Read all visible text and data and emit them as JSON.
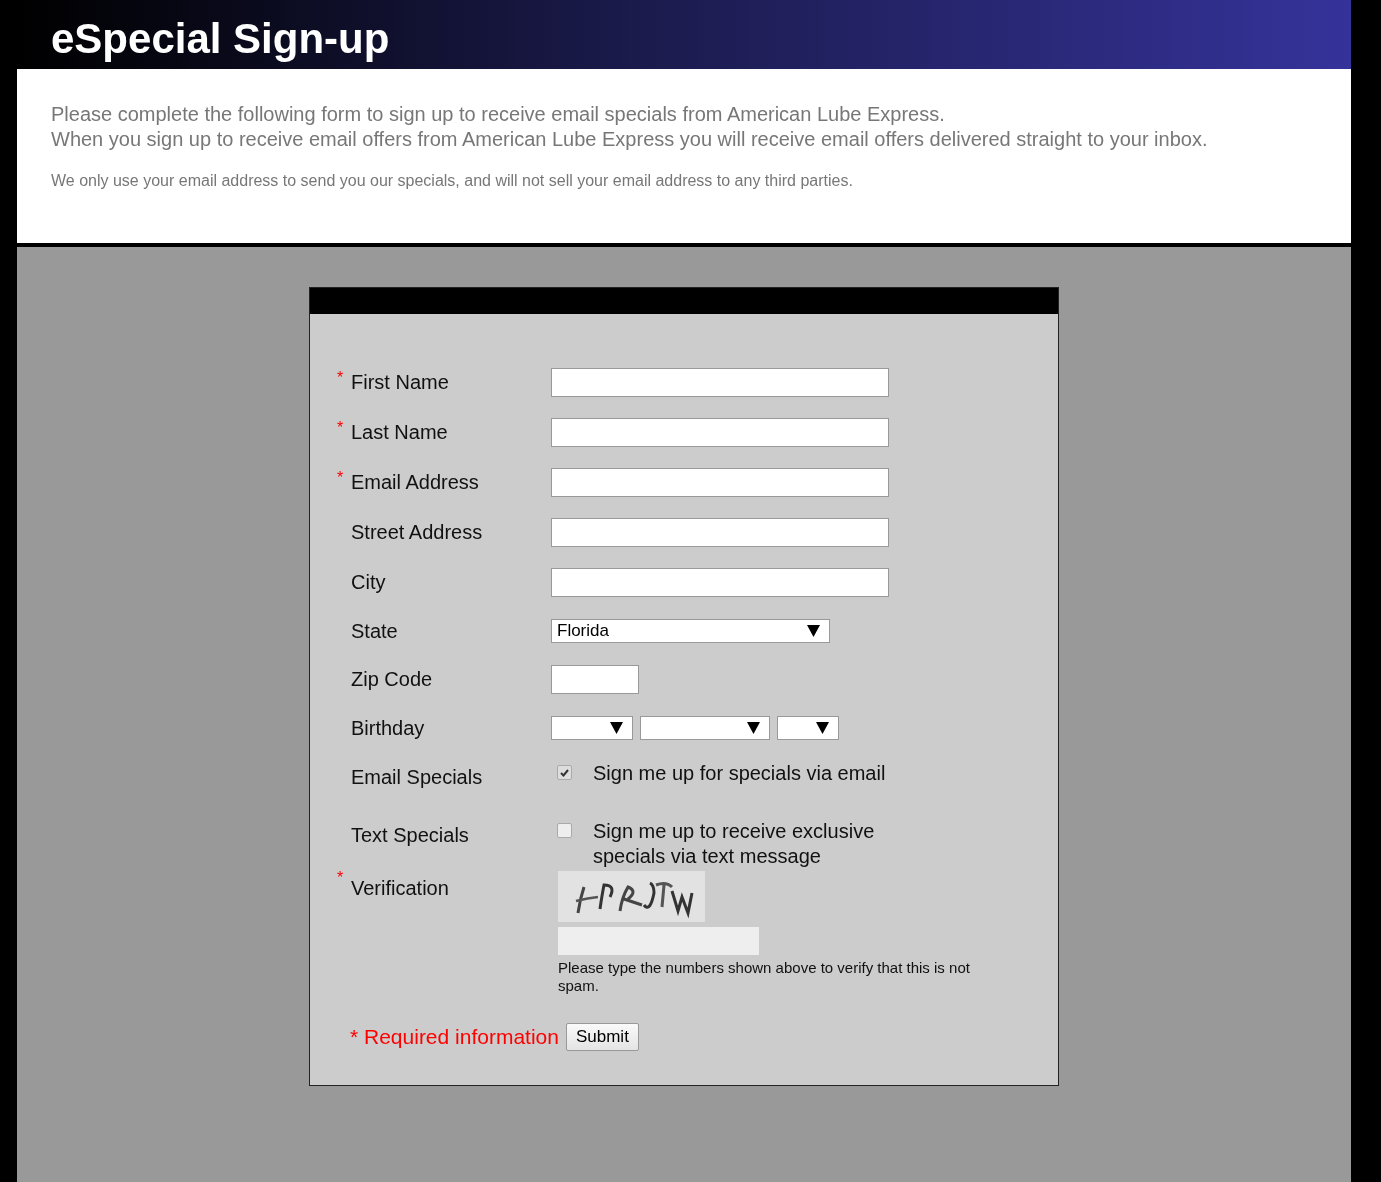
{
  "header": {
    "title": "eSpecial Sign-up"
  },
  "intro": {
    "lines": [
      "Please complete the following form to sign up to receive email specials from American Lube Express.",
      "When you sign up to receive email offers from American Lube Express you will receive email offers delivered straight to your inbox."
    ],
    "note": "We only use your email address to send you our specials, and will not sell your email address to any third parties."
  },
  "form": {
    "required_mark": "*",
    "fields": [
      {
        "kind": "text",
        "label": "First Name",
        "required": true
      },
      {
        "kind": "text",
        "label": "Last Name",
        "required": true
      },
      {
        "kind": "text",
        "label": "Email Address",
        "required": true
      },
      {
        "kind": "text",
        "label": "Street Address",
        "required": false
      },
      {
        "kind": "text",
        "label": "City",
        "required": false
      },
      {
        "kind": "select",
        "label": "State",
        "required": false,
        "value": "Florida"
      },
      {
        "kind": "zip",
        "label": "Zip Code",
        "required": false
      },
      {
        "kind": "date",
        "label": "Birthday",
        "required": false
      },
      {
        "kind": "checkbox",
        "label": "Email Specials",
        "required": false,
        "option": "Sign me up for specials via email",
        "checked": true
      },
      {
        "kind": "checkbox",
        "label": "Text Specials",
        "required": false,
        "option": "Sign me up to receive exclusive specials via text message",
        "checked": false
      },
      {
        "kind": "captcha",
        "label": "Verification",
        "required": true,
        "hint": "Please type the numbers shown above to verify that this is not spam."
      }
    ],
    "required_note": "* Required information",
    "submit": "Submit"
  }
}
